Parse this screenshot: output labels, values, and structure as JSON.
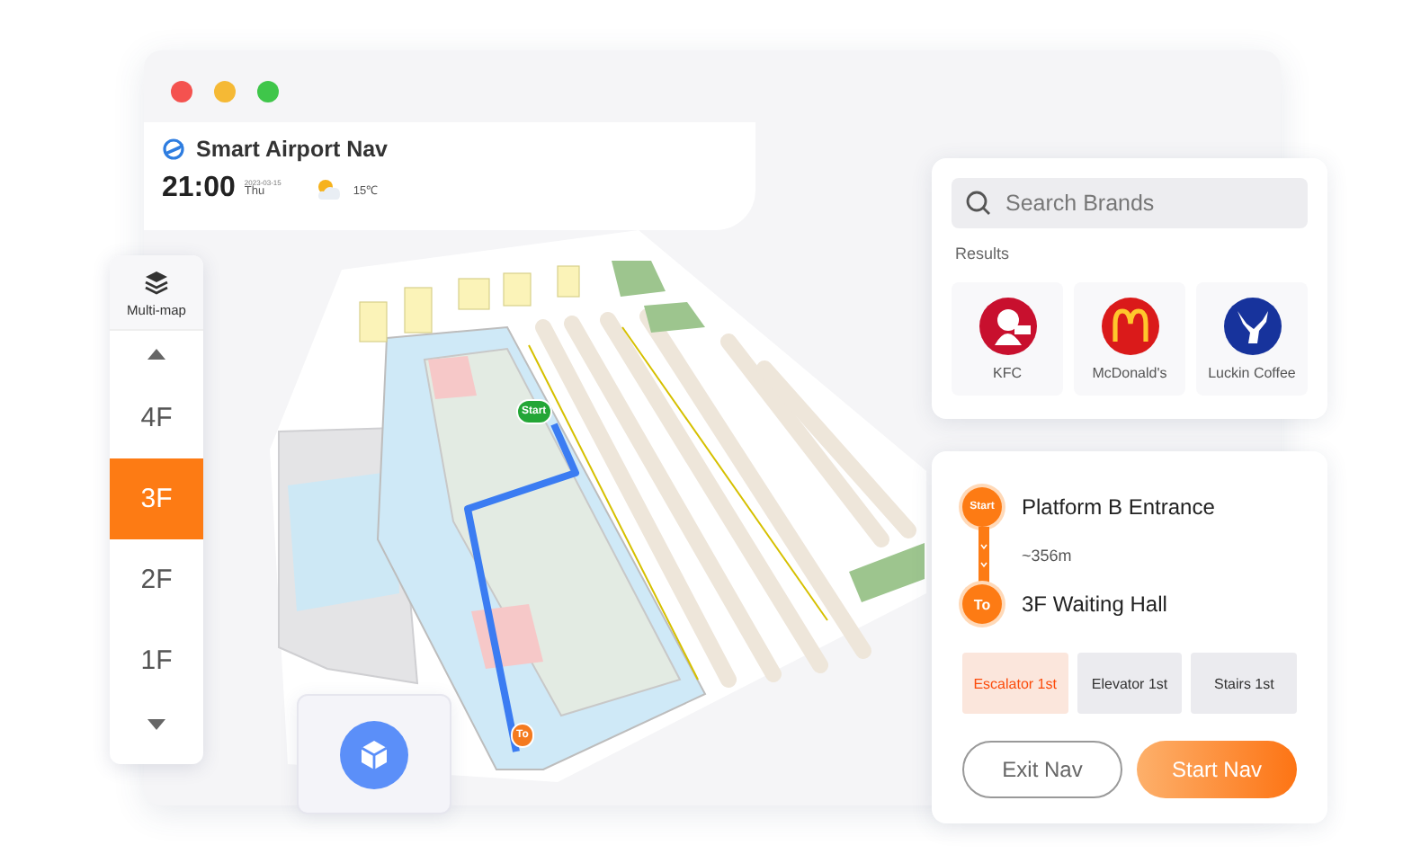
{
  "window": {
    "title": "Smart Airport Nav"
  },
  "status": {
    "time": "21:00",
    "date": "2023-03-15",
    "weekday": "Thu",
    "temperature": "15℃"
  },
  "floor_picker": {
    "label": "Multi-map",
    "floors": [
      {
        "label": "4F",
        "selected": false
      },
      {
        "label": "3F",
        "selected": true
      },
      {
        "label": "2F",
        "selected": false
      },
      {
        "label": "1F",
        "selected": false
      }
    ]
  },
  "map": {
    "start_pin": "Start",
    "end_pin": "To"
  },
  "search": {
    "placeholder": "Search Brands",
    "results_label": "Results",
    "results": [
      {
        "name": "KFC",
        "kind": "kfc"
      },
      {
        "name": "McDonald's",
        "kind": "mcdonalds"
      },
      {
        "name": "Luckin Coffee",
        "kind": "luckin"
      }
    ]
  },
  "route": {
    "start_badge": "Start",
    "from": "Platform B Entrance",
    "distance": "~356m",
    "end_badge": "To",
    "to": "3F Waiting Hall",
    "preferences": [
      {
        "label": "Escalator 1st",
        "selected": true
      },
      {
        "label": "Elevator 1st",
        "selected": false
      },
      {
        "label": "Stairs 1st",
        "selected": false
      }
    ],
    "buttons": [
      {
        "label": "Exit Nav",
        "kind": "secondary"
      },
      {
        "label": "Start Nav",
        "kind": "primary"
      }
    ]
  }
}
